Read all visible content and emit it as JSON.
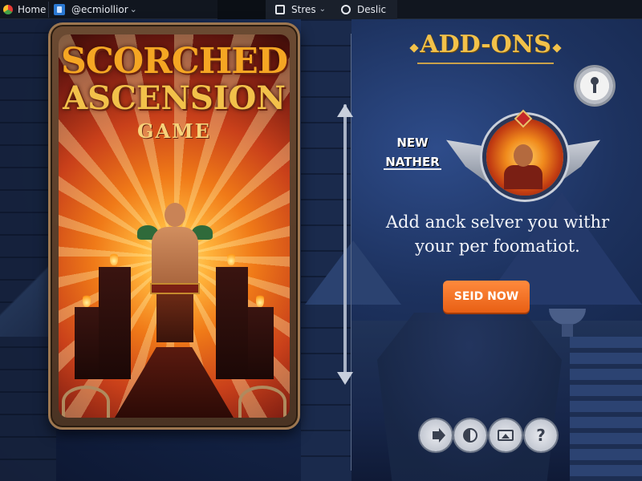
{
  "topbar": {
    "home_label": "Home",
    "account_label": "@ecmiollior",
    "account_caret": "⌄",
    "store_label": "Stres",
    "store_caret": "⌄",
    "desk_label": "Deslic"
  },
  "game_card": {
    "title_line1": "SCORCHED",
    "title_line2": "ASCENSION",
    "title_line3": "GAME"
  },
  "addons": {
    "title": "ADD-ONS",
    "new_label_line1": "NEW",
    "new_label_line2": "NATHER",
    "promo_line1": "Add anck selver you withr",
    "promo_line2": "your per foomatiot.",
    "cta_label": "SEID NOW",
    "help_glyph": "?"
  },
  "icons": [
    "home-icon",
    "account-icon",
    "store-bag-icon",
    "clock-icon",
    "gear-lock-icon",
    "emblem-icon",
    "speaker-icon",
    "contrast-icon",
    "image-icon",
    "help-icon"
  ],
  "colors": {
    "title_gold": "#f5a623",
    "addons_gold": "#f2c14a",
    "cta_orange": "#e85f14",
    "bg_navy": "#142447"
  }
}
